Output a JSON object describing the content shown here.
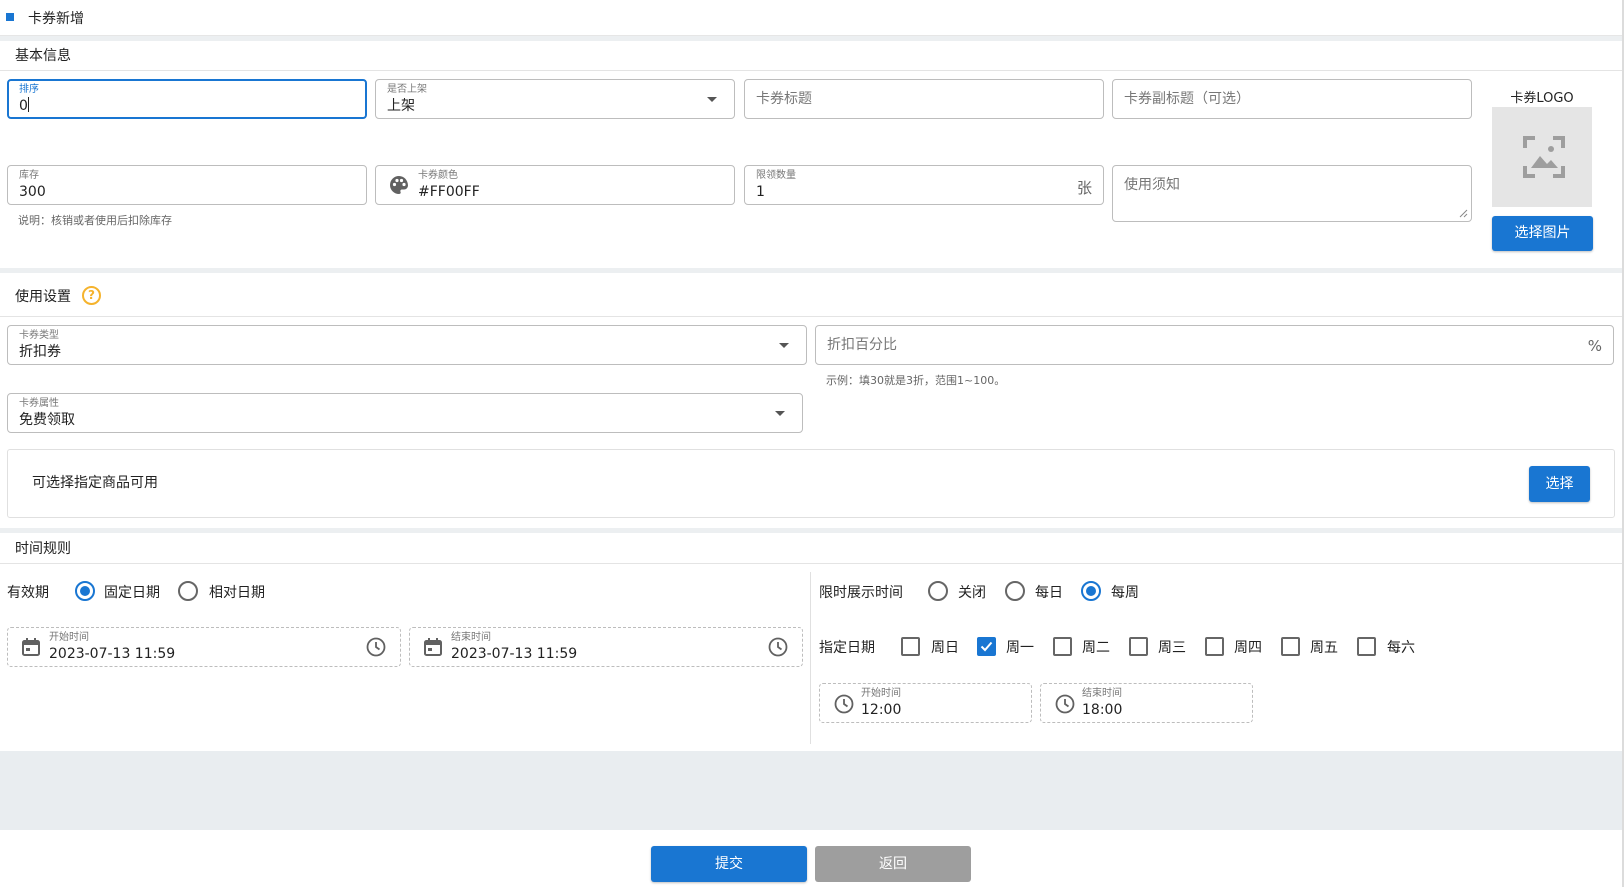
{
  "page": {
    "title": "卡券新增"
  },
  "basic": {
    "section_title": "基本信息",
    "sort": {
      "label": "排序",
      "value": "0"
    },
    "shelf": {
      "label": "是否上架",
      "value": "上架"
    },
    "title_placeholder": "卡券标题",
    "subtitle_placeholder": "卡券副标题（可选）",
    "logo_label": "卡券LOGO",
    "choose_image": "选择图片",
    "stock": {
      "label": "库存",
      "value": "300",
      "helper": "说明：核销或者使用后扣除库存"
    },
    "color": {
      "label": "卡券颜色",
      "value": "#FF00FF"
    },
    "limit": {
      "label": "限领数量",
      "value": "1",
      "suffix": "张"
    },
    "notice_placeholder": "使用须知"
  },
  "usage": {
    "section_title": "使用设置",
    "help_glyph": "?",
    "type": {
      "label": "卡券类型",
      "value": "折扣券"
    },
    "discount": {
      "placeholder": "折扣百分比",
      "suffix": "%",
      "helper": "示例：填30就是3折，范围1~100。"
    },
    "attr": {
      "label": "卡券属性",
      "value": "免费领取"
    },
    "goods_text": "可选择指定商品可用",
    "goods_button": "选择"
  },
  "time": {
    "section_title": "时间规则",
    "validity": {
      "label": "有效期",
      "options": [
        {
          "label": "固定日期",
          "selected": true
        },
        {
          "label": "相对日期",
          "selected": false
        }
      ],
      "start": {
        "label": "开始时间",
        "value": "2023-07-13 11:59"
      },
      "end": {
        "label": "结束时间",
        "value": "2023-07-13 11:59"
      }
    },
    "display": {
      "label": "限时展示时间",
      "options": [
        {
          "label": "关闭",
          "selected": false
        },
        {
          "label": "每日",
          "selected": false
        },
        {
          "label": "每周",
          "selected": true
        }
      ]
    },
    "days": {
      "label": "指定日期",
      "items": [
        {
          "label": "周日",
          "checked": false
        },
        {
          "label": "周一",
          "checked": true
        },
        {
          "label": "周二",
          "checked": false
        },
        {
          "label": "周三",
          "checked": false
        },
        {
          "label": "周四",
          "checked": false
        },
        {
          "label": "周五",
          "checked": false
        },
        {
          "label": "每六",
          "checked": false
        }
      ]
    },
    "daily_start": {
      "label": "开始时间",
      "value": "12:00"
    },
    "daily_end": {
      "label": "结束时间",
      "value": "18:00"
    }
  },
  "footer": {
    "submit": "提交",
    "back": "返回"
  },
  "colors": {
    "primary": "#1976d2",
    "help": "#f5b32d",
    "grey_button": "#9e9e9e"
  },
  "icons": {
    "header": "square-marker-icon",
    "dropdown": "dropdown-arrow-icon",
    "palette": "palette-icon",
    "image": "image-placeholder-icon",
    "help": "question-circle-icon",
    "calendar": "calendar-icon",
    "clock": "clock-icon"
  }
}
